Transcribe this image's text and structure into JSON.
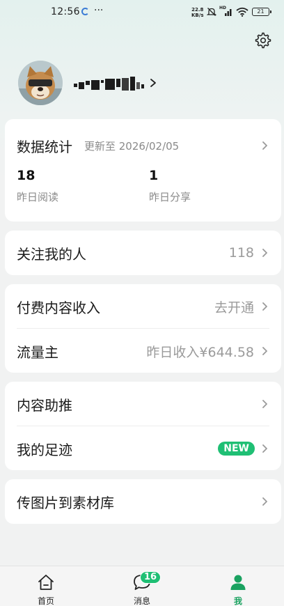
{
  "status_bar": {
    "time": "12:56",
    "dots": "···",
    "net_speed_value": "22.8",
    "net_speed_unit": "KB/s",
    "hd": "HD",
    "battery": "21"
  },
  "profile": {
    "username": "(pixelated)",
    "icons": [
      "settings-icon",
      "chevron-right-icon"
    ]
  },
  "stats": {
    "title": "数据统计",
    "updated": "更新至 2026/02/05",
    "items": [
      {
        "value": "18",
        "label": "昨日阅读"
      },
      {
        "value": "1",
        "label": "昨日分享"
      }
    ]
  },
  "rows": {
    "followers": {
      "title": "关注我的人",
      "value": "118"
    },
    "paid_income": {
      "title": "付费内容收入",
      "value": "去开通"
    },
    "traffic_owner": {
      "title": "流量主",
      "value": "昨日收入¥644.58"
    },
    "content_boost": {
      "title": "内容助推"
    },
    "my_footprints": {
      "title": "我的足迹",
      "badge": "NEW"
    },
    "upload_images": {
      "title": "传图片到素材库"
    }
  },
  "bottom_nav": {
    "items": [
      {
        "label": "首页",
        "icon": "home-icon"
      },
      {
        "label": "消息",
        "icon": "chat-bubble-icon",
        "badge": "16"
      },
      {
        "label": "我",
        "icon": "person-icon",
        "active": true
      }
    ]
  },
  "colors": {
    "accent": "#1fbf74",
    "active_tab": "#1aa260",
    "card_bg": "#ffffff",
    "page_bg": "#f1f2f2"
  }
}
